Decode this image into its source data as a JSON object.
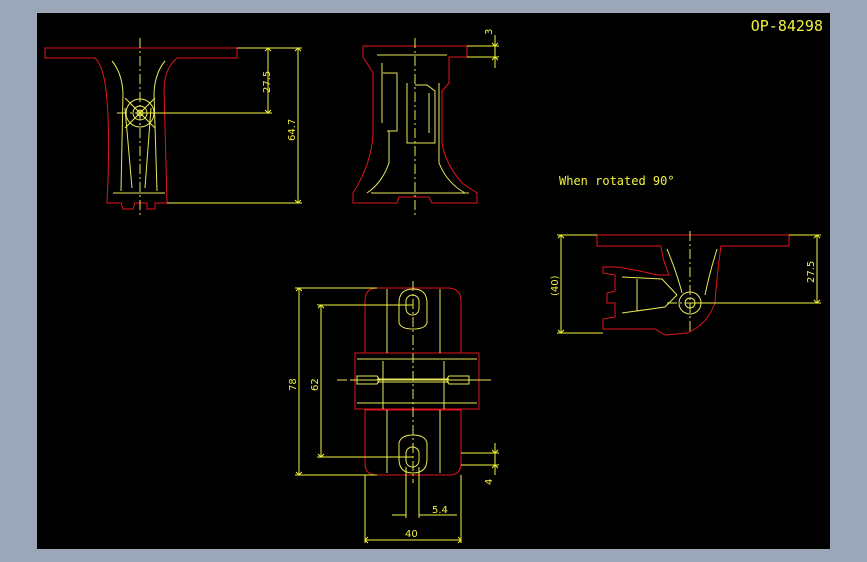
{
  "drawing": {
    "part_number": "OP-84298",
    "note_rotated": "When rotated 90°",
    "colors": {
      "background": "#000000",
      "border": "#9ba7b8",
      "outline": "#e1141e",
      "detail": "#e8e85a",
      "dimension": "#f2f23c",
      "title_text": "#f2f23c"
    },
    "dimensions": {
      "front_small_height": "27.5",
      "front_total_height": "64.7",
      "side_top_thickness": "3",
      "rotated_height_paren": "(40)",
      "rotated_small_height": "27.5",
      "plan_overall_height": "78",
      "plan_slot_pitch": "62",
      "plan_slot_width": "5.4",
      "plan_overall_width": "40",
      "plan_edge_offset": "4"
    }
  }
}
